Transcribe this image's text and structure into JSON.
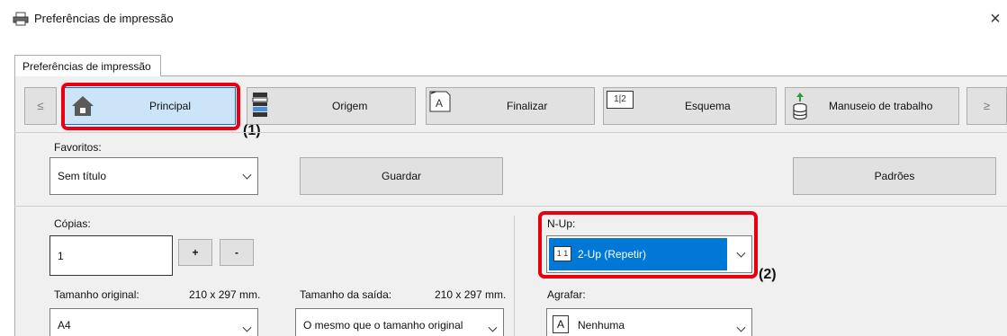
{
  "window": {
    "title": "Preferências de impressão",
    "close_glyph": "×",
    "icon": "printer-icon"
  },
  "tab": {
    "label": "Preferências de impressão"
  },
  "toolbar": {
    "prev_label": "≤",
    "next_label": "≥",
    "buttons": [
      {
        "label": "Principal",
        "icon": "home-icon",
        "selected": true
      },
      {
        "label": "Origem",
        "icon": "paper-tray-icon"
      },
      {
        "label": "Finalizar",
        "icon": "finish-icon"
      },
      {
        "label": "Esquema",
        "icon": "layout-icon",
        "icon_text": "1|2"
      },
      {
        "label": "Manuseio de trabalho",
        "icon": "job-handling-icon"
      }
    ]
  },
  "favorites": {
    "label": "Favoritos:",
    "value": "Sem título",
    "save_label": "Guardar",
    "defaults_label": "Padrões"
  },
  "copies": {
    "label": "Cópias:",
    "value": "1",
    "plus": "+",
    "minus": "-"
  },
  "nup": {
    "label": "N-Up:",
    "value": "2-Up (Repetir)",
    "icon_text": "1 1"
  },
  "original_size": {
    "label": "Tamanho original:",
    "dims": "210 x 297 mm.",
    "value": "A4"
  },
  "output_size": {
    "label": "Tamanho da saída:",
    "dims": "210 x 297 mm.",
    "value": "O mesmo que o tamanho original"
  },
  "staple": {
    "label": "Agrafar:",
    "value": "Nenhuma",
    "icon_text": "A"
  },
  "annotations": {
    "one": "(1)",
    "two": "(2)"
  },
  "colors": {
    "callout": "#e60012",
    "selected_blue": "#0078d7",
    "selected_tab": "#cce4f7"
  }
}
